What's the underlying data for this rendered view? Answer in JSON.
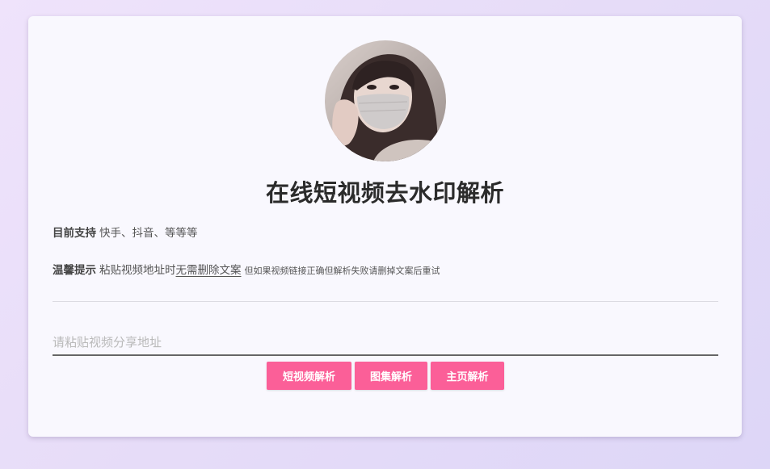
{
  "header": {
    "title": "在线短视频去水印解析"
  },
  "info": {
    "support_label": "目前支持",
    "support_text": "快手、抖音、等等等",
    "tip_label": "温馨提示",
    "tip_text_prefix": "粘贴视频地址时",
    "tip_text_emphasis": "无需删除文案",
    "tip_text_small": "但如果视频链接正确但解析失败请删掉文案后重试"
  },
  "input": {
    "value": "",
    "placeholder": "请粘贴视频分享地址"
  },
  "buttons": {
    "video_label": "短视频解析",
    "album_label": "图集解析",
    "home_label": "主页解析"
  },
  "colors": {
    "accent": "#fb5f98",
    "card_bg": "#f9f8fe",
    "title": "#2b2b2b"
  }
}
